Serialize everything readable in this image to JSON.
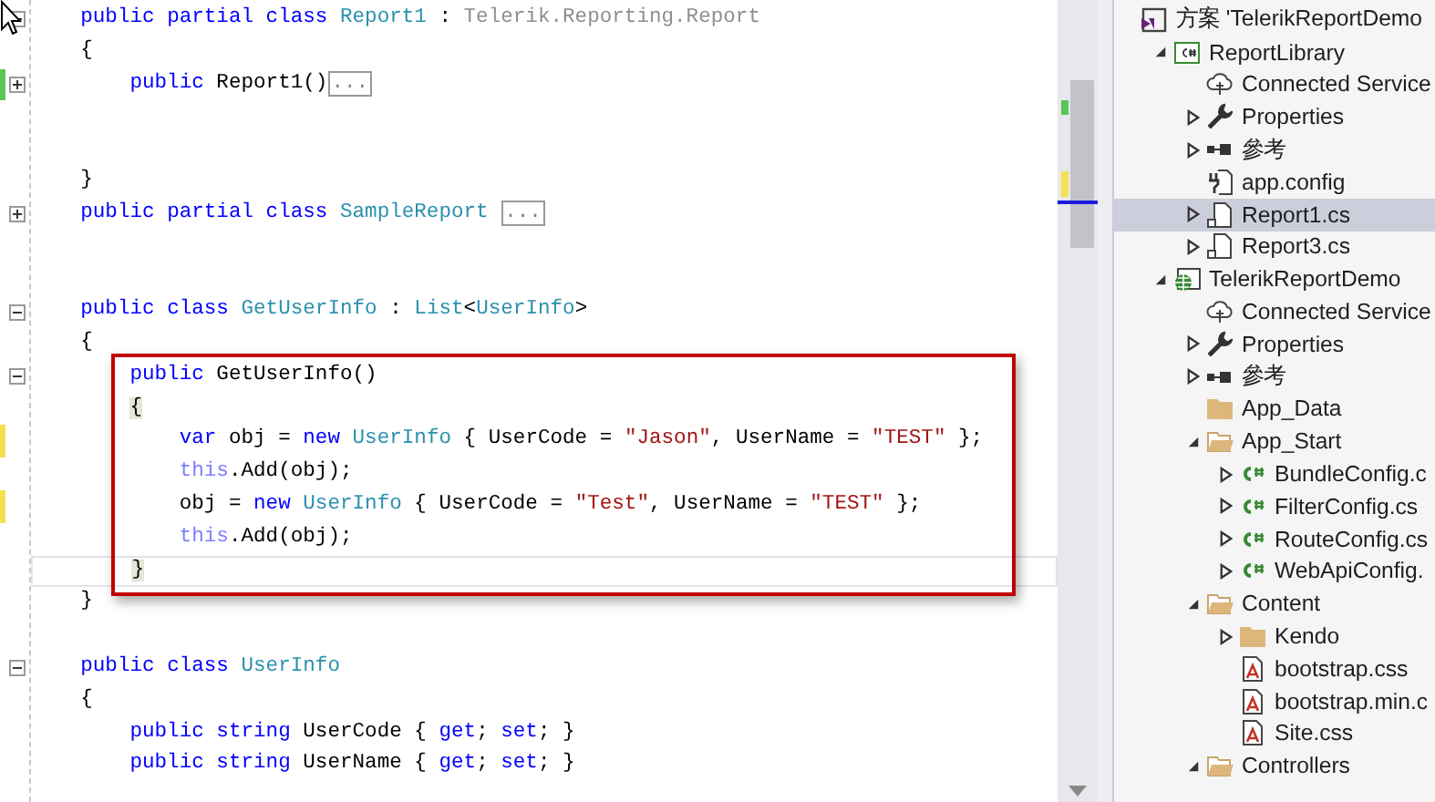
{
  "editor": {
    "lines": [
      {
        "kind": "code",
        "folded": false,
        "tokens": [
          {
            "kind": "keyword",
            "text": "public partial class"
          },
          {
            "kind": "type",
            "text": " Report1"
          },
          {
            "kind": "plain",
            "text": " : "
          },
          {
            "kind": "dim",
            "text": "Telerik.Reporting.Report"
          }
        ]
      },
      {
        "kind": "code",
        "tokens": [
          {
            "kind": "plain",
            "text": "{"
          }
        ]
      },
      {
        "kind": "code",
        "folded": true,
        "saved": true,
        "tokens": [
          {
            "kind": "keyword",
            "text": "public"
          },
          {
            "kind": "plain",
            "text": " Report1()"
          },
          {
            "kind": "collapsed",
            "text": "..."
          }
        ]
      },
      {
        "kind": "blank"
      },
      {
        "kind": "blank"
      },
      {
        "kind": "code",
        "tokens": [
          {
            "kind": "plain",
            "text": "}"
          }
        ]
      },
      {
        "kind": "code",
        "folded": true,
        "tokens": [
          {
            "kind": "keyword",
            "text": "public partial class"
          },
          {
            "kind": "type",
            "text": " SampleReport "
          },
          {
            "kind": "collapsed",
            "text": "..."
          }
        ]
      },
      {
        "kind": "blank"
      },
      {
        "kind": "blank"
      },
      {
        "kind": "code",
        "folded": false,
        "tokens": [
          {
            "kind": "keyword",
            "text": "public class"
          },
          {
            "kind": "type",
            "text": " GetUserInfo"
          },
          {
            "kind": "plain",
            "text": " : "
          },
          {
            "kind": "type",
            "text": "List"
          },
          {
            "kind": "plain",
            "text": "<"
          },
          {
            "kind": "type",
            "text": "UserInfo"
          },
          {
            "kind": "plain",
            "text": ">"
          }
        ]
      },
      {
        "kind": "code",
        "tokens": [
          {
            "kind": "plain",
            "text": "{"
          }
        ]
      },
      {
        "kind": "highlight-group",
        "lines": [
          {
            "kind": "code",
            "folded": false,
            "tokens": [
              {
                "kind": "keyword",
                "text": "public"
              },
              {
                "kind": "plain",
                "text": " GetUserInfo()"
              }
            ]
          },
          {
            "kind": "code",
            "tokens": [
              {
                "kind": "brace-match",
                "text": "{"
              }
            ]
          },
          {
            "kind": "code",
            "saved": false,
            "tokens": [
              {
                "kind": "keyword",
                "text": "var"
              },
              {
                "kind": "plain",
                "text": " obj = "
              },
              {
                "kind": "keyword",
                "text": "new"
              },
              {
                "kind": "type",
                "text": " UserInfo"
              },
              {
                "kind": "plain",
                "text": " { UserCode = "
              },
              {
                "kind": "string",
                "text": "\"Jason\""
              },
              {
                "kind": "plain",
                "text": ", UserName = "
              },
              {
                "kind": "string",
                "text": "\"TEST\""
              },
              {
                "kind": "plain",
                "text": " };"
              }
            ]
          },
          {
            "kind": "code",
            "tokens": [
              {
                "kind": "faded-keyword",
                "text": "this"
              },
              {
                "kind": "plain",
                "text": ".Add(obj);"
              }
            ]
          },
          {
            "kind": "code",
            "saved": false,
            "tokens": [
              {
                "kind": "plain",
                "text": "obj = "
              },
              {
                "kind": "keyword",
                "text": "new"
              },
              {
                "kind": "type",
                "text": " UserInfo"
              },
              {
                "kind": "plain",
                "text": " { UserCode = "
              },
              {
                "kind": "string",
                "text": "\"Test\""
              },
              {
                "kind": "plain",
                "text": ", UserName = "
              },
              {
                "kind": "string",
                "text": "\"TEST\""
              },
              {
                "kind": "plain",
                "text": " };"
              }
            ]
          },
          {
            "kind": "code",
            "tokens": [
              {
                "kind": "faded-keyword",
                "text": "this"
              },
              {
                "kind": "plain",
                "text": ".Add(obj);"
              }
            ]
          },
          {
            "kind": "code",
            "current": true,
            "tokens": [
              {
                "kind": "brace-match",
                "text": "}"
              }
            ]
          }
        ]
      },
      {
        "kind": "code",
        "tokens": [
          {
            "kind": "plain",
            "text": "}"
          }
        ]
      },
      {
        "kind": "blank"
      },
      {
        "kind": "code",
        "folded": false,
        "tokens": [
          {
            "kind": "keyword",
            "text": "public class"
          },
          {
            "kind": "type",
            "text": " UserInfo"
          }
        ]
      },
      {
        "kind": "code",
        "tokens": [
          {
            "kind": "plain",
            "text": "{"
          }
        ]
      },
      {
        "kind": "code",
        "tokens": [
          {
            "kind": "keyword",
            "text": "public string"
          },
          {
            "kind": "plain",
            "text": " UserCode { "
          },
          {
            "kind": "keyword",
            "text": "get"
          },
          {
            "kind": "plain",
            "text": "; "
          },
          {
            "kind": "keyword",
            "text": "set"
          },
          {
            "kind": "plain",
            "text": "; }"
          }
        ]
      },
      {
        "kind": "code",
        "tokens": [
          {
            "kind": "keyword",
            "text": "public string"
          },
          {
            "kind": "plain",
            "text": " UserName { "
          },
          {
            "kind": "keyword",
            "text": "get"
          },
          {
            "kind": "plain",
            "text": "; "
          },
          {
            "kind": "keyword",
            "text": "set"
          },
          {
            "kind": "plain",
            "text": "; }"
          }
        ]
      }
    ]
  },
  "solution_explorer": {
    "items": [
      {
        "label": "方案 'TelerikReportDemo",
        "kind": "solution",
        "selected": false,
        "children": [
          {
            "label": "ReportLibrary",
            "kind": "csharp-project",
            "expanded": true,
            "selected": false,
            "children": [
              {
                "label": "Connected Service",
                "kind": "connected",
                "selected": false
              },
              {
                "label": "Properties",
                "kind": "properties",
                "expanded": false,
                "selected": false
              },
              {
                "label": "參考",
                "kind": "references",
                "expanded": false,
                "selected": false
              },
              {
                "label": "app.config",
                "kind": "config",
                "selected": false
              },
              {
                "label": "Report1.cs",
                "kind": "report",
                "expanded": false,
                "selected": true
              },
              {
                "label": "Report3.cs",
                "kind": "report",
                "expanded": false,
                "selected": false
              }
            ]
          },
          {
            "label": "TelerikReportDemo",
            "kind": "web-project",
            "expanded": true,
            "selected": false,
            "children": [
              {
                "label": "Connected Service",
                "kind": "connected",
                "selected": false
              },
              {
                "label": "Properties",
                "kind": "properties",
                "expanded": false,
                "selected": false
              },
              {
                "label": "參考",
                "kind": "references",
                "expanded": false,
                "selected": false
              },
              {
                "label": "App_Data",
                "kind": "folder",
                "selected": false
              },
              {
                "label": "App_Start",
                "kind": "folder",
                "expanded": true,
                "selected": false,
                "children": [
                  {
                    "label": "BundleConfig.c",
                    "kind": "code",
                    "expanded": false,
                    "selected": false
                  },
                  {
                    "label": "FilterConfig.cs",
                    "kind": "code",
                    "expanded": false,
                    "selected": false
                  },
                  {
                    "label": "RouteConfig.cs",
                    "kind": "code",
                    "expanded": false,
                    "selected": false
                  },
                  {
                    "label": "WebApiConfig.",
                    "kind": "code",
                    "expanded": false,
                    "selected": false
                  }
                ]
              },
              {
                "label": "Content",
                "kind": "folder",
                "expanded": true,
                "selected": false,
                "children": [
                  {
                    "label": "Kendo",
                    "kind": "folder",
                    "expanded": false,
                    "selected": false
                  },
                  {
                    "label": "bootstrap.css",
                    "kind": "stylesheet",
                    "selected": false
                  },
                  {
                    "label": "bootstrap.min.c",
                    "kind": "stylesheet",
                    "selected": false
                  },
                  {
                    "label": "Site.css",
                    "kind": "stylesheet",
                    "selected": false
                  }
                ]
              },
              {
                "label": "Controllers",
                "kind": "folder",
                "expanded": true,
                "selected": false
              }
            ]
          }
        ]
      }
    ]
  }
}
